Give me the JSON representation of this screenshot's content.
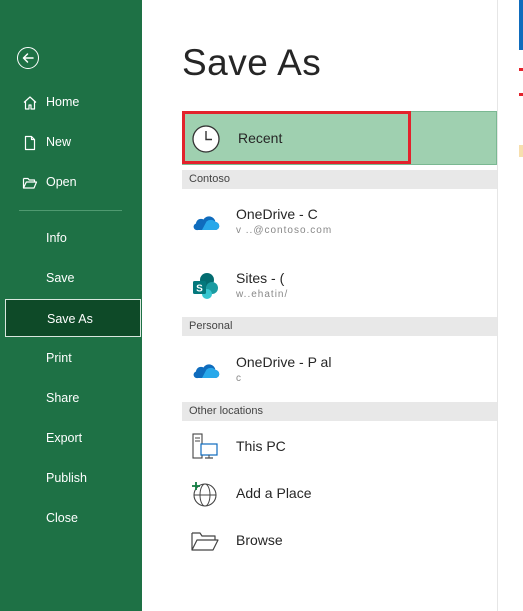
{
  "nav": {
    "back_icon": "back-arrow-icon",
    "items": [
      {
        "label": "Home",
        "icon": "home-icon"
      },
      {
        "label": "New",
        "icon": "new-document-icon"
      },
      {
        "label": "Open",
        "icon": "open-folder-icon"
      },
      {
        "label": "Info"
      },
      {
        "label": "Save"
      },
      {
        "label": "Save As",
        "selected": true
      },
      {
        "label": "Print"
      },
      {
        "label": "Share"
      },
      {
        "label": "Export"
      },
      {
        "label": "Publish"
      },
      {
        "label": "Close"
      }
    ]
  },
  "main": {
    "title": "Save As",
    "recent": {
      "label": "Recent",
      "icon": "clock-icon"
    },
    "groups": {
      "contoso": "Contoso",
      "personal": "Personal",
      "other": "Other locations"
    },
    "locations": {
      "onedrive_contoso": {
        "name": "OneDrive - C",
        "sub": "v                    ..@contoso.com",
        "icon": "onedrive-cloud-icon"
      },
      "sites_contoso": {
        "name": "Sites - (",
        "sub": "w..ehatin/                                  ",
        "icon": "sharepoint-icon"
      },
      "onedrive_personal": {
        "name": "OneDrive - P           al",
        "sub": "c",
        "icon": "onedrive-cloud-icon"
      },
      "this_pc": {
        "name": "This PC",
        "icon": "computer-icon"
      },
      "add_place": {
        "name": "Add a Place",
        "icon": "add-place-globe-icon"
      },
      "browse": {
        "name": "Browse",
        "icon": "folder-icon"
      }
    }
  },
  "colors": {
    "backstage_green": "#1e7145",
    "selected_nav": "#0e4a28",
    "recent_fill": "#9fd0b0",
    "highlight_red": "#e3222c",
    "onedrive_blue": "#0f6cbd",
    "sharepoint_teal": "#038387"
  }
}
